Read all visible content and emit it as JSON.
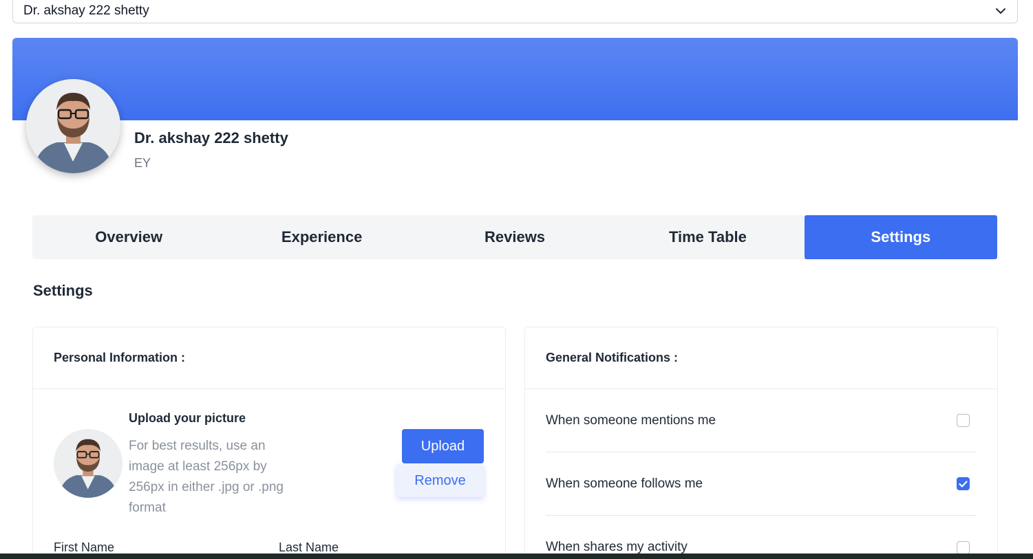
{
  "doctor_select": {
    "selected": "Dr. akshay 222 shetty"
  },
  "profile": {
    "name": "Dr. akshay 222 shetty",
    "org": "EY",
    "banner_color": "#4a7bf1"
  },
  "tabs": [
    {
      "label": "Overview",
      "active": false
    },
    {
      "label": "Experience",
      "active": false
    },
    {
      "label": "Reviews",
      "active": false
    },
    {
      "label": "Time Table",
      "active": false
    },
    {
      "label": "Settings",
      "active": true
    }
  ],
  "settings_heading": "Settings",
  "personal_info": {
    "title": "Personal Information :",
    "upload_title": "Upload your picture",
    "upload_help": "For best results, use an image at least 256px by 256px in either .jpg or .png format",
    "upload_label": "Upload",
    "remove_label": "Remove",
    "first_name_label": "First Name",
    "last_name_label": "Last Name"
  },
  "notifications": {
    "title": "General Notifications :",
    "items": [
      {
        "label": "When someone mentions me",
        "checked": false
      },
      {
        "label": "When someone follows me",
        "checked": true
      },
      {
        "label": "When shares my activity",
        "checked": false
      }
    ]
  },
  "colors": {
    "primary": "#3b6ef0",
    "muted_text": "#8a919c"
  }
}
